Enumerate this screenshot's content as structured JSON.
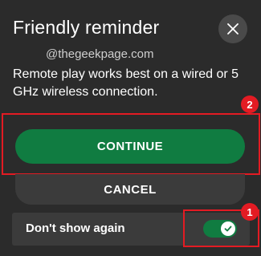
{
  "dialog": {
    "title": "Friendly reminder",
    "watermark": "@thegeekpage.com",
    "message": "Remote play works best on a wired or 5 GHz wireless connection.",
    "close_icon": "close-icon"
  },
  "buttons": {
    "continue_label": "CONTINUE",
    "cancel_label": "CANCEL"
  },
  "option": {
    "dont_show_label": "Don't show again",
    "toggle_on": true,
    "check_icon": "checkmark-icon"
  },
  "annotations": {
    "badge_toggle": "1",
    "badge_continue": "2",
    "highlight_color": "#e31b23"
  },
  "colors": {
    "background": "#2b2b2b",
    "accent_green": "#107c41",
    "button_gray": "#3b3b3b",
    "close_bg": "#4a4a4a"
  }
}
